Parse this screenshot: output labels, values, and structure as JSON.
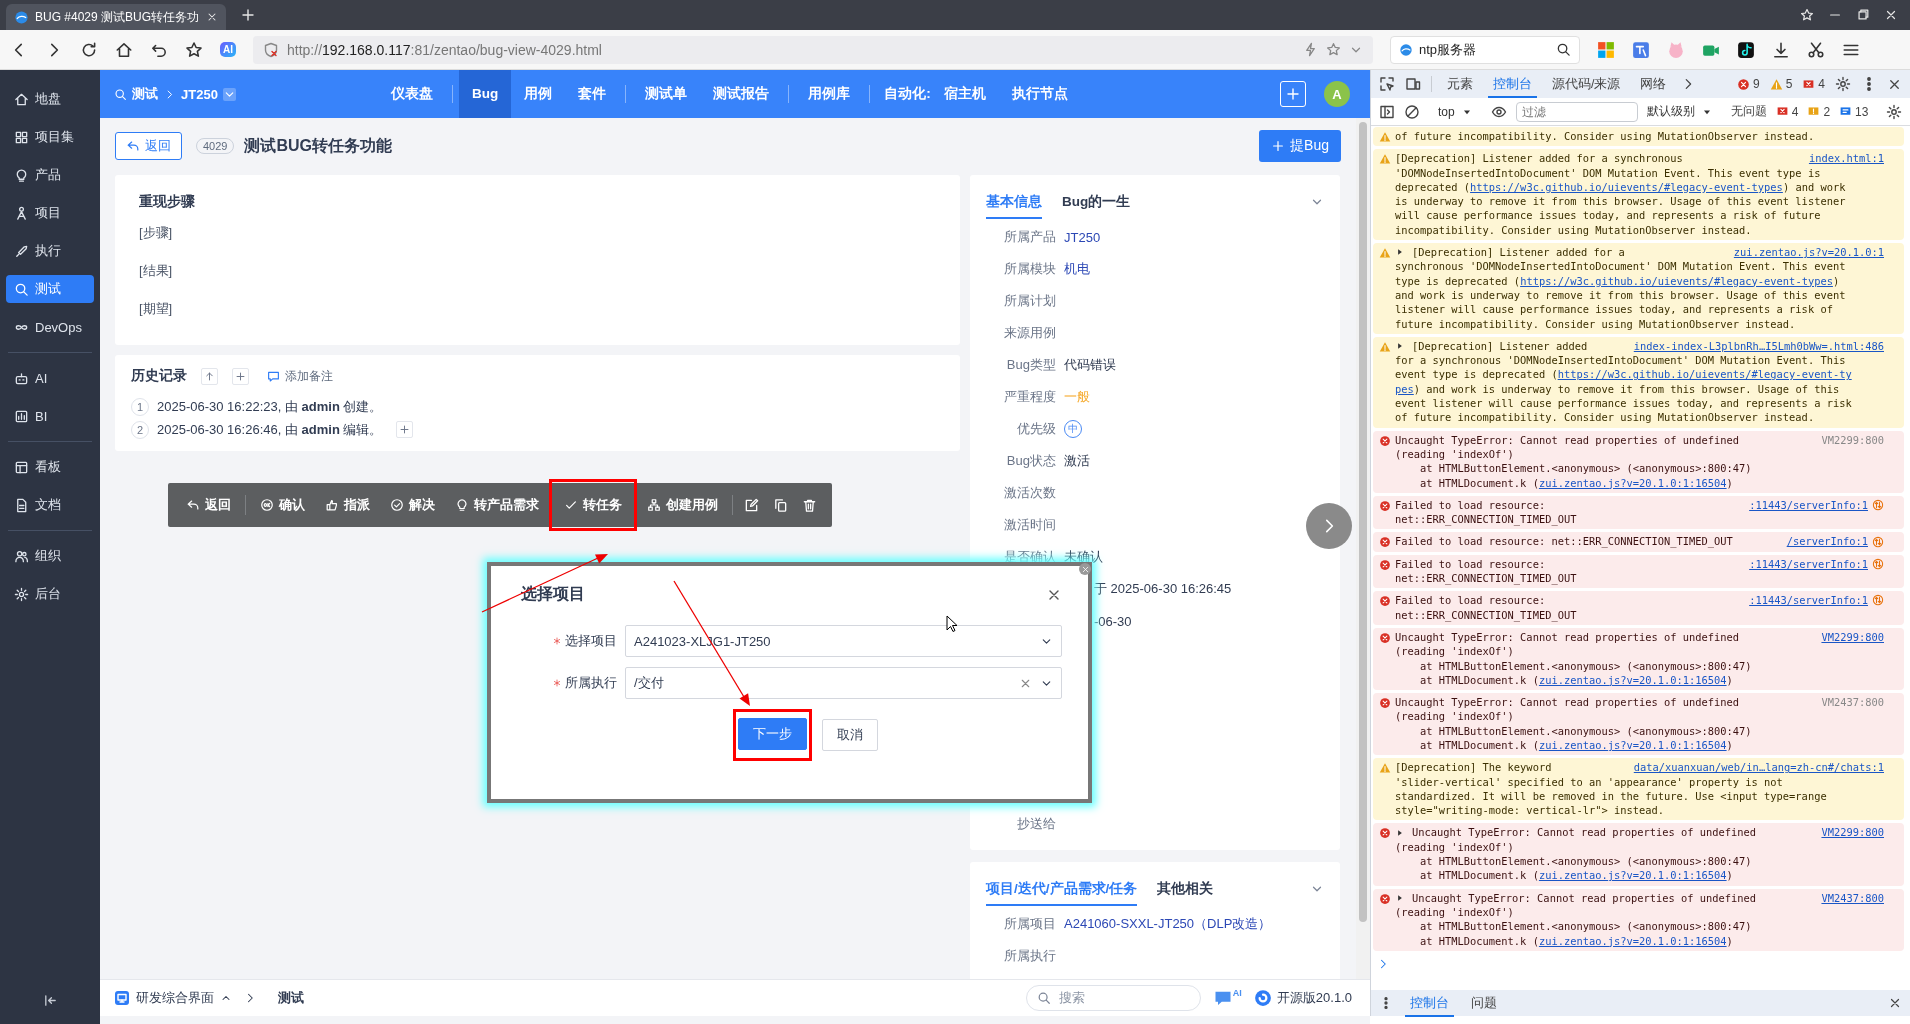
{
  "browser": {
    "tab_title": "BUG #4029 测试BUG转任务功",
    "url": {
      "scheme": "http://",
      "host": "192.168.0.117",
      "path": ":81/zentao/bug-view-4029.html"
    },
    "ai_badge": "AI",
    "search_value": "ntp服务器"
  },
  "sidebar": {
    "groups": [
      [
        {
          "label": "地盘",
          "selected": false
        },
        {
          "label": "项目集",
          "selected": false
        },
        {
          "label": "产品",
          "selected": false
        },
        {
          "label": "项目",
          "selected": false
        },
        {
          "label": "执行",
          "selected": false
        },
        {
          "label": "测试",
          "selected": true
        },
        {
          "label": "DevOps",
          "selected": false
        }
      ],
      [
        {
          "label": "AI",
          "selected": false
        },
        {
          "label": "BI",
          "selected": false
        }
      ],
      [
        {
          "label": "看板",
          "selected": false
        },
        {
          "label": "文档",
          "selected": false
        }
      ],
      [
        {
          "label": "组织",
          "selected": false
        },
        {
          "label": "后台",
          "selected": false
        }
      ]
    ]
  },
  "topnav": {
    "breadcrumb": [
      "测试",
      "JT250"
    ],
    "groups": [
      [
        {
          "label": "仪表盘",
          "kind": "tab",
          "selected": false
        }
      ],
      [
        {
          "label": "Bug",
          "kind": "tab",
          "selected": true
        },
        {
          "label": "用例",
          "kind": "tab",
          "selected": false
        },
        {
          "label": "套件",
          "kind": "tab",
          "selected": false
        }
      ],
      [
        {
          "label": "测试单",
          "kind": "tab",
          "selected": false
        },
        {
          "label": "测试报告",
          "kind": "tab",
          "selected": false
        }
      ],
      [
        {
          "label": "用例库",
          "kind": "tab",
          "selected": false
        }
      ],
      [
        {
          "label": "自动化:",
          "kind": "label"
        },
        {
          "label": "宿主机",
          "kind": "tab",
          "selected": false
        },
        {
          "label": "执行节点",
          "kind": "tab",
          "selected": false
        }
      ]
    ],
    "avatar": "A"
  },
  "title_bar": {
    "back": "返回",
    "id": "4029",
    "title": "测试BUG转任务功能",
    "report_button": "提Bug"
  },
  "steps_card": {
    "heading": "重现步骤",
    "lines": [
      "[步骤]",
      "[结果]",
      "[期望]"
    ]
  },
  "history": {
    "heading": "历史记录",
    "add_note": "添加备注",
    "entries": [
      {
        "index": "1",
        "text": "2025-06-30 16:22:23, 由 **admin** 创建。",
        "expandable": false
      },
      {
        "index": "2",
        "text": "2025-06-30 16:26:46, 由 **admin** 编辑。",
        "expandable": true
      }
    ]
  },
  "toolbar": {
    "groups": [
      [
        {
          "label": "返回",
          "highlighted": false
        }
      ],
      [
        {
          "label": "确认",
          "highlighted": false
        },
        {
          "label": "指派",
          "highlighted": false
        },
        {
          "label": "解决",
          "highlighted": false
        },
        {
          "label": "转产品需求",
          "highlighted": false
        },
        {
          "label": "转任务",
          "highlighted": true
        },
        {
          "label": "创建用例",
          "highlighted": false
        }
      ]
    ]
  },
  "info_panel": {
    "tabs": [
      {
        "label": "基本信息",
        "selected": true
      },
      {
        "label": "Bug的一生",
        "selected": false
      }
    ],
    "rows": [
      {
        "label": "所属产品",
        "value": "JT250",
        "kind": "link"
      },
      {
        "label": "所属模块",
        "value": "机电",
        "kind": "link"
      },
      {
        "label": "所属计划"
      },
      {
        "label": "来源用例"
      },
      {
        "label": "Bug类型",
        "value": "代码错误",
        "kind": "text"
      },
      {
        "label": "严重程度",
        "value": "一般",
        "kind": "severity"
      },
      {
        "label": "优先级",
        "value": "中",
        "kind": "priority"
      },
      {
        "label": "Bug状态",
        "value": "激活",
        "kind": "text"
      },
      {
        "label": "激活次数"
      },
      {
        "label": "激活时间"
      },
      {
        "label": "是否确认",
        "value": "未确认",
        "kind": "text"
      },
      {
        "value": "于 2025-06-30 16:26:45",
        "kind": "text"
      },
      {
        "value": "-06-30",
        "kind": "text"
      },
      {
        "label": "抄送给"
      }
    ]
  },
  "related_panel": {
    "tabs": [
      {
        "label": "项目/迭代/产品需求/任务",
        "selected": true
      },
      {
        "label": "其他相关",
        "selected": false
      }
    ],
    "rows": [
      {
        "label": "所属项目",
        "value": "A241060-SXXL-JT250（DLP改造）",
        "kind": "link"
      },
      {
        "label": "所属执行"
      }
    ]
  },
  "bottom_bar": {
    "menu": "研发综合界面",
    "crumb": "测试",
    "search_placeholder": "搜索",
    "ai_label": "AI",
    "version": "开源版20.1.0"
  },
  "dialog": {
    "title": "选择项目",
    "fields": [
      {
        "label": "选择项目",
        "required": true,
        "value": "A241023-XLJG1-JT250",
        "clearable": false
      },
      {
        "label": "所属执行",
        "required": true,
        "value": "/交付",
        "clearable": true
      }
    ],
    "buttons": [
      {
        "label": "下一步",
        "kind": "primary",
        "highlighted": true
      },
      {
        "label": "取消",
        "kind": "default",
        "highlighted": false
      }
    ]
  },
  "devtools": {
    "tabs": [
      {
        "label": "元素",
        "selected": false
      },
      {
        "label": "控制台",
        "selected": true
      },
      {
        "label": "源代码/来源",
        "selected": false
      },
      {
        "label": "网络",
        "selected": false
      }
    ],
    "counts": [
      {
        "kind": "error",
        "count": "9"
      },
      {
        "kind": "warning",
        "count": "5"
      },
      {
        "kind": "issue",
        "count": "4"
      }
    ],
    "context": "top",
    "filter_placeholder": "过滤",
    "level": "默认级别",
    "issues_label": "无问题",
    "issue_counts": [
      {
        "kind": "error",
        "count": "4"
      },
      {
        "kind": "warning",
        "count": "2"
      },
      {
        "kind": "info",
        "count": "13"
      }
    ],
    "messages": [
      {
        "kind": "warning",
        "expandable": false,
        "parts": [
          {
            "text": "of future incompatibility. Consider using MutationObserver instead."
          }
        ]
      },
      {
        "kind": "warning",
        "expandable": false,
        "source": "index.html:1",
        "source_link": true,
        "parts": [
          {
            "text": "[Deprecation] Listener added for a synchronous\n'DOMNodeInsertedIntoDocument' DOM Mutation Event. This event type is\ndeprecated ("
          },
          {
            "link": "https://w3c.github.io/uievents/#legacy-event-types"
          },
          {
            "text": ") and work\nis underway to remove it from this browser. Usage of this event listener\nwill cause performance issues today, and represents a risk of future\nincompatibility. Consider using MutationObserver instead."
          }
        ]
      },
      {
        "kind": "warning",
        "expandable": true,
        "source": "zui.zentao.js?v=20.1.0:1",
        "source_link": true,
        "parts": [
          {
            "text": "[Deprecation] Listener added for a\nsynchronous 'DOMNodeInsertedIntoDocument' DOM Mutation Event. This event\ntype is deprecated ("
          },
          {
            "link": "https://w3c.github.io/uievents/#legacy-event-types"
          },
          {
            "text": ")\nand work is underway to remove it from this browser. Usage of this event\nlistener will cause performance issues today, and represents a risk of\nfuture incompatibility. Consider using MutationObserver instead."
          }
        ]
      },
      {
        "kind": "warning",
        "expandable": true,
        "source": "index-index-L3plbnRh…I5Lmh0bWw=.html:486",
        "source_link": true,
        "parts": [
          {
            "text": "[Deprecation] Listener added\nfor a synchronous 'DOMNodeInsertedIntoDocument' DOM Mutation Event. This\nevent type is deprecated ("
          },
          {
            "link": "https://w3c.github.io/uievents/#legacy-event-ty"
          },
          {
            "link": "pes",
            "break_before": true
          },
          {
            "text": ") and work is underway to remove it from this browser. Usage of this\nevent listener will cause performance issues today, and represents a risk\nof future incompatibility. Consider using MutationObserver instead."
          }
        ]
      },
      {
        "kind": "error",
        "expandable": false,
        "source": "VM2299:800",
        "source_link": false,
        "parts": [
          {
            "text": "Uncaught TypeError: Cannot read properties of undefined\n(reading 'indexOf')\n    at HTMLButtonElement.<anonymous> (<anonymous>:800:47)\n    at HTMLDocument.k ("
          },
          {
            "link": "zui.zentao.js?v=20.1.0:1:16504"
          },
          {
            "text": ")"
          }
        ]
      },
      {
        "kind": "error",
        "expandable": false,
        "source": ":11443/serverInfo:1",
        "source_link": true,
        "network": true,
        "parts": [
          {
            "text": "Failed to load resource:\nnet::ERR_CONNECTION_TIMED_OUT"
          }
        ]
      },
      {
        "kind": "error",
        "expandable": false,
        "source": "/serverInfo:1",
        "source_link": true,
        "network": true,
        "parts": [
          {
            "text": "Failed to load resource: net::ERR_CONNECTION_TIMED_OUT"
          }
        ]
      },
      {
        "kind": "error",
        "expandable": false,
        "source": ":11443/serverInfo:1",
        "source_link": true,
        "network": true,
        "parts": [
          {
            "text": "Failed to load resource:\nnet::ERR_CONNECTION_TIMED_OUT"
          }
        ]
      },
      {
        "kind": "error",
        "expandable": false,
        "source": ":11443/serverInfo:1",
        "source_link": true,
        "network": true,
        "parts": [
          {
            "text": "Failed to load resource:\nnet::ERR_CONNECTION_TIMED_OUT"
          }
        ]
      },
      {
        "kind": "error",
        "expandable": false,
        "source": "VM2299:800",
        "source_link": true,
        "parts": [
          {
            "text": "Uncaught TypeError: Cannot read properties of undefined\n(reading 'indexOf')\n    at HTMLButtonElement.<anonymous> (<anonymous>:800:47)\n    at HTMLDocument.k ("
          },
          {
            "link": "zui.zentao.js?v=20.1.0:1:16504"
          },
          {
            "text": ")"
          }
        ]
      },
      {
        "kind": "error",
        "expandable": false,
        "source": "VM2437:800",
        "source_link": false,
        "parts": [
          {
            "text": "Uncaught TypeError: Cannot read properties of undefined\n(reading 'indexOf')\n    at HTMLButtonElement.<anonymous> (<anonymous>:800:47)\n    at HTMLDocument.k ("
          },
          {
            "link": "zui.zentao.js?v=20.1.0:1:16504"
          },
          {
            "text": ")"
          }
        ]
      },
      {
        "kind": "warning",
        "expandable": false,
        "source": "data/xuanxuan/web/in…lang=zh-cn#/chats:1",
        "source_link": true,
        "parts": [
          {
            "text": "[Deprecation] The keyword\n'slider-vertical' specified to an 'appearance' property is not\nstandardized. It will be removed in the future. Use <input type=range\nstyle=\"writing-mode: vertical-lr\"> instead."
          }
        ]
      },
      {
        "kind": "error",
        "expandable": true,
        "source": "VM2299:800",
        "source_link": true,
        "parts": [
          {
            "text": "Uncaught TypeError: Cannot read properties of undefined\n(reading 'indexOf')\n    at HTMLButtonElement.<anonymous> (<anonymous>:800:47)\n    at HTMLDocument.k ("
          },
          {
            "link": "zui.zentao.js?v=20.1.0:1:16504"
          },
          {
            "text": ")"
          }
        ]
      },
      {
        "kind": "error",
        "expandable": true,
        "source": "VM2437:800",
        "source_link": true,
        "parts": [
          {
            "text": "Uncaught TypeError: Cannot read properties of undefined\n(reading 'indexOf')\n    at HTMLButtonElement.<anonymous> (<anonymous>:800:47)\n    at HTMLDocument.k ("
          },
          {
            "link": "zui.zentao.js?v=20.1.0:1:16504"
          },
          {
            "text": ")"
          }
        ]
      }
    ],
    "drawer_tabs": [
      {
        "label": "控制台",
        "selected": true
      },
      {
        "label": "问题",
        "selected": false
      }
    ]
  }
}
